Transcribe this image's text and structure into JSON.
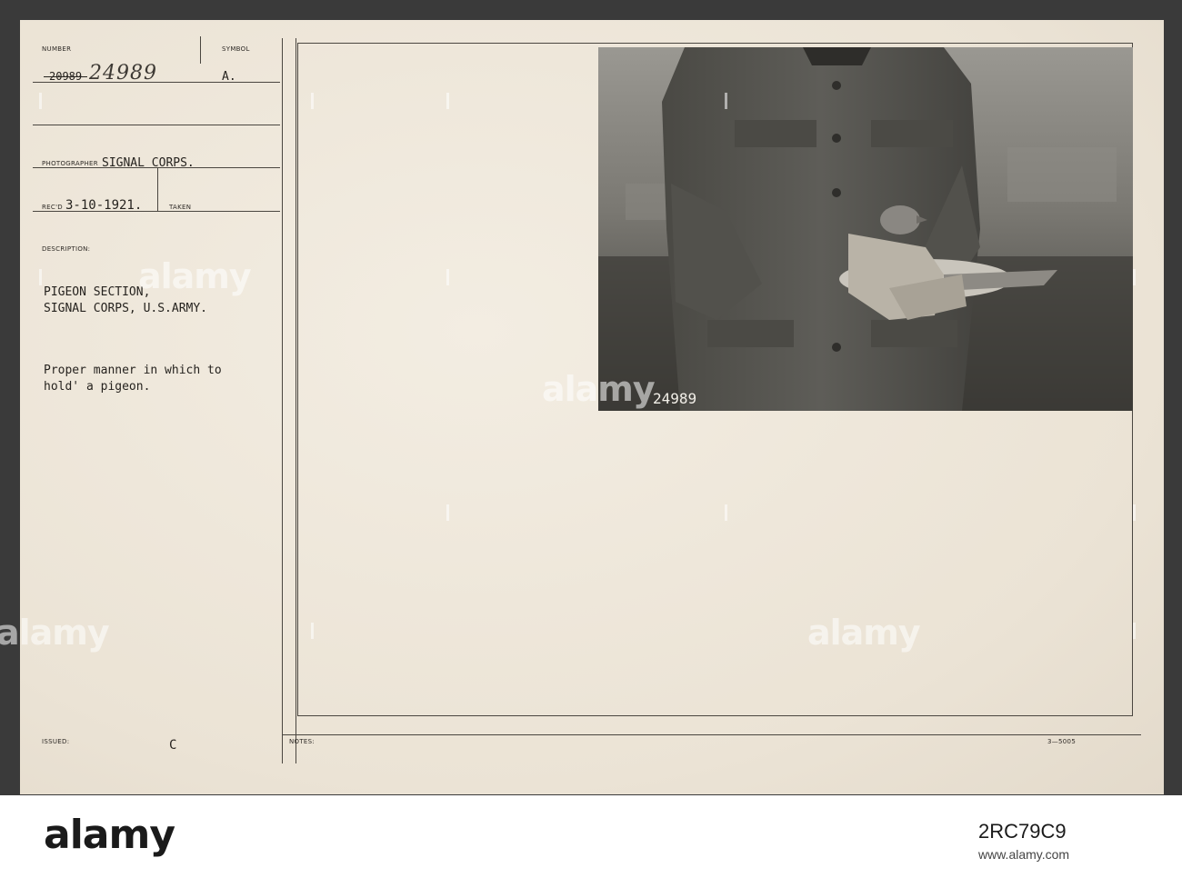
{
  "card": {
    "labels": {
      "number": "NUMBER",
      "symbol": "SYMBOL",
      "photographer": "PHOTOGRAPHER",
      "recd": "REC'D",
      "taken": "TAKEN",
      "description": "DESCRIPTION:",
      "issued": "ISSUED:",
      "notes": "NOTES:"
    },
    "number_typed": "20989",
    "number_handwritten": "24989",
    "symbol_value": "A.",
    "photographer_value": "SIGNAL CORPS.",
    "recd_value": "3-10-1921.",
    "description_line1": "PIGEON SECTION,",
    "description_line2": "SIGNAL CORPS, U.S.ARMY.",
    "caption_line1": "Proper manner in which to",
    "caption_line2": "hold' a pigeon.",
    "issued_mark": "C",
    "form_code": "3—5005"
  },
  "photo": {
    "negative_number": "24989"
  },
  "watermark": {
    "text": "alamy"
  },
  "footer": {
    "logo": "alamy",
    "image_id": "2RC79C9",
    "url": "www.alamy.com"
  }
}
